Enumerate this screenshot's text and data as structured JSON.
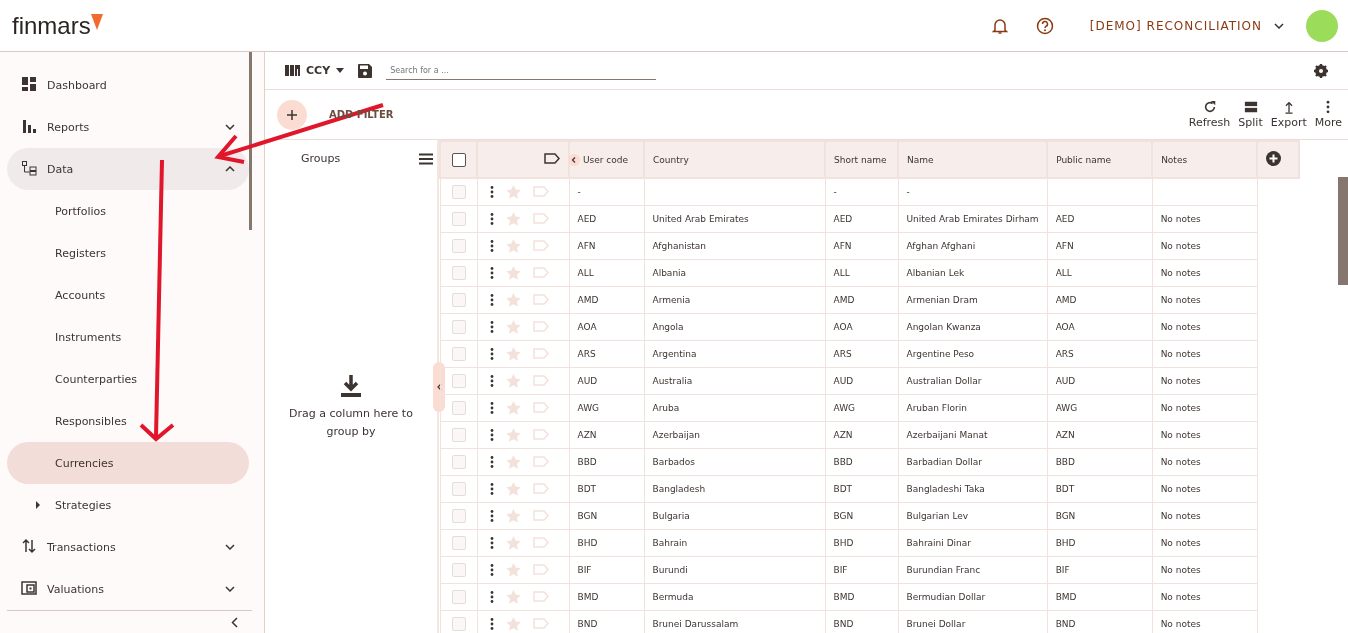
{
  "header": {
    "logo": "finmars",
    "workspace": "[DEMO] RECONCILIATION"
  },
  "sidebar": {
    "items": [
      {
        "label": "Dashboard",
        "selected": false
      },
      {
        "label": "Reports",
        "selected": false,
        "expanded": false
      },
      {
        "label": "Data",
        "selected": false,
        "expanded": true,
        "children": [
          {
            "label": "Portfolios",
            "selected": false
          },
          {
            "label": "Registers",
            "selected": false
          },
          {
            "label": "Accounts",
            "selected": false
          },
          {
            "label": "Instruments",
            "selected": false
          },
          {
            "label": "Counterparties",
            "selected": false
          },
          {
            "label": "Responsibles",
            "selected": false
          },
          {
            "label": "Currencies",
            "selected": true
          },
          {
            "label": "Strategies",
            "selected": false,
            "expanded": false
          }
        ]
      },
      {
        "label": "Transactions",
        "selected": false,
        "expanded": false
      },
      {
        "label": "Valuations",
        "selected": false,
        "expanded": false
      }
    ]
  },
  "toolbar": {
    "layout": "CCY",
    "search": {
      "placeholder": "Search for a ..."
    },
    "add_filter": "ADD FILTER",
    "actions": [
      "Refresh",
      "Split",
      "Export",
      "More"
    ]
  },
  "groups": {
    "title": "Groups",
    "hint": "Drag a column here to group by"
  },
  "table": {
    "header_checked": false,
    "columns": [
      "User code",
      "Country",
      "Short name",
      "Name",
      "Public name",
      "Notes"
    ],
    "rows": [
      {
        "checked": false,
        "cells": [
          "-",
          "",
          "-",
          "-",
          "",
          ""
        ]
      },
      {
        "checked": false,
        "cells": [
          "AED",
          "United Arab Emirates",
          "AED",
          "United Arab Emirates Dirham",
          "AED",
          "No notes"
        ]
      },
      {
        "checked": false,
        "cells": [
          "AFN",
          "Afghanistan",
          "AFN",
          "Afghan Afghani",
          "AFN",
          "No notes"
        ]
      },
      {
        "checked": false,
        "cells": [
          "ALL",
          "Albania",
          "ALL",
          "Albanian Lek",
          "ALL",
          "No notes"
        ]
      },
      {
        "checked": false,
        "cells": [
          "AMD",
          "Armenia",
          "AMD",
          "Armenian Dram",
          "AMD",
          "No notes"
        ]
      },
      {
        "checked": false,
        "cells": [
          "AOA",
          "Angola",
          "AOA",
          "Angolan Kwanza",
          "AOA",
          "No notes"
        ]
      },
      {
        "checked": false,
        "cells": [
          "ARS",
          "Argentina",
          "ARS",
          "Argentine Peso",
          "ARS",
          "No notes"
        ]
      },
      {
        "checked": false,
        "cells": [
          "AUD",
          "Australia",
          "AUD",
          "Australian Dollar",
          "AUD",
          "No notes"
        ]
      },
      {
        "checked": false,
        "cells": [
          "AWG",
          "Aruba",
          "AWG",
          "Aruban Florin",
          "AWG",
          "No notes"
        ]
      },
      {
        "checked": false,
        "cells": [
          "AZN",
          "Azerbaijan",
          "AZN",
          "Azerbaijani Manat",
          "AZN",
          "No notes"
        ]
      },
      {
        "checked": false,
        "cells": [
          "BBD",
          "Barbados",
          "BBD",
          "Barbadian Dollar",
          "BBD",
          "No notes"
        ]
      },
      {
        "checked": false,
        "cells": [
          "BDT",
          "Bangladesh",
          "BDT",
          "Bangladeshi Taka",
          "BDT",
          "No notes"
        ]
      },
      {
        "checked": false,
        "cells": [
          "BGN",
          "Bulgaria",
          "BGN",
          "Bulgarian Lev",
          "BGN",
          "No notes"
        ]
      },
      {
        "checked": false,
        "cells": [
          "BHD",
          "Bahrain",
          "BHD",
          "Bahraini Dinar",
          "BHD",
          "No notes"
        ]
      },
      {
        "checked": false,
        "cells": [
          "BIF",
          "Burundi",
          "BIF",
          "Burundian Franc",
          "BIF",
          "No notes"
        ]
      },
      {
        "checked": false,
        "cells": [
          "BMD",
          "Bermuda",
          "BMD",
          "Bermudian Dollar",
          "BMD",
          "No notes"
        ]
      },
      {
        "checked": false,
        "cells": [
          "BND",
          "Brunei Darussalam",
          "BND",
          "Brunei Dollar",
          "BND",
          "No notes"
        ]
      }
    ]
  }
}
